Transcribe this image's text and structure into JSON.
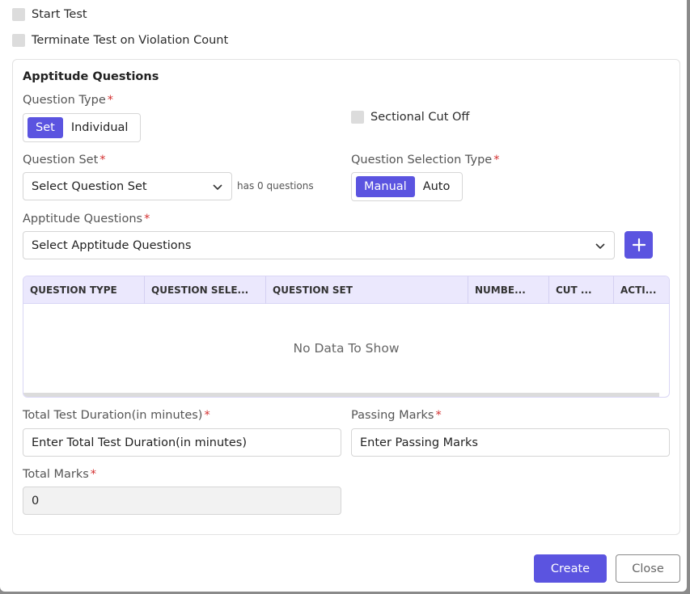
{
  "options": {
    "start_test_label": "Start Test",
    "terminate_label": "Terminate Test on Violation Count"
  },
  "card": {
    "title": "Apptitude Questions",
    "question_type": {
      "label": "Question Type",
      "required_mark": "*",
      "options": [
        "Set",
        "Individual"
      ],
      "selected": "Set"
    },
    "sectional_cut_off_label": "Sectional Cut Off",
    "question_set": {
      "label": "Question Set",
      "required_mark": "*",
      "value": "Select Question Set",
      "hint": "has 0 questions"
    },
    "question_selection_type": {
      "label": "Question Selection Type",
      "required_mark": "*",
      "options": [
        "Manual",
        "Auto"
      ],
      "selected": "Manual"
    },
    "apptitude_questions": {
      "label": "Apptitude Questions",
      "required_mark": "*",
      "value": "Select Apptitude Questions",
      "add_icon": "plus-icon"
    },
    "table": {
      "columns": [
        "QUESTION TYPE",
        "QUESTION SELE...",
        "QUESTION SET",
        "NUMBE...",
        "CUT ...",
        "ACTI..."
      ],
      "empty_text": "No Data To Show"
    },
    "total_duration": {
      "label": "Total Test Duration(in minutes)",
      "required_mark": "*",
      "placeholder": "Enter Total Test Duration(in minutes)"
    },
    "passing_marks": {
      "label": "Passing Marks",
      "required_mark": "*",
      "placeholder": "Enter Passing Marks"
    },
    "total_marks": {
      "label": "Total Marks",
      "required_mark": "*",
      "value": "0"
    }
  },
  "footer": {
    "create_label": "Create",
    "close_label": "Close"
  },
  "colors": {
    "accent": "#5b54e0",
    "table_header_bg": "#ebe8fd",
    "required": "#d32f2f"
  }
}
